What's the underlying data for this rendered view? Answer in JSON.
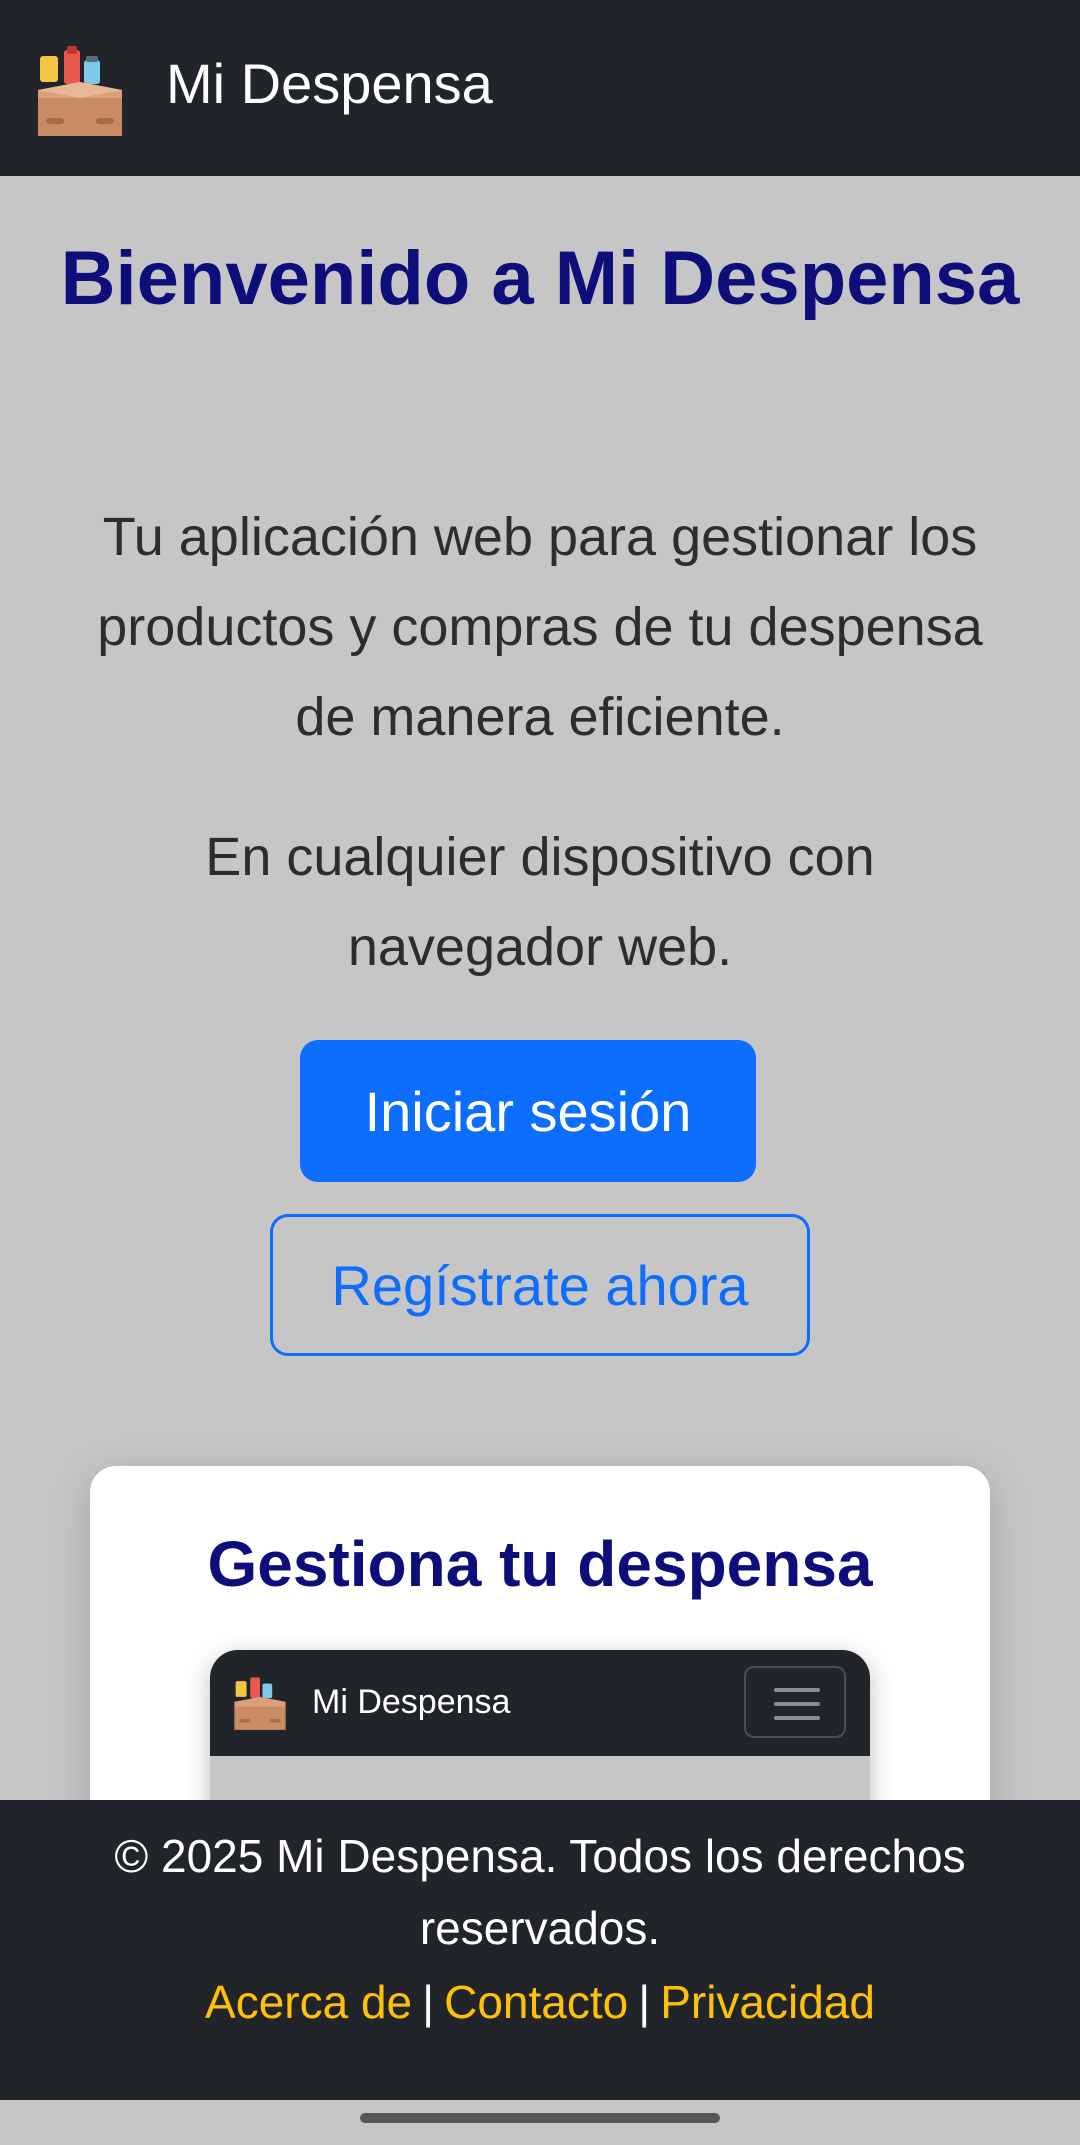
{
  "header": {
    "brand": "Mi Despensa",
    "logo_icon": "pantry-box-icon"
  },
  "hero": {
    "title": "Bienvenido a Mi Despensa",
    "description": "Tu aplicación web para gestionar los productos y compras de tu despensa de manera eficiente.",
    "devices_note": "En cualquier dispositivo con navegador web.",
    "login_label": "Iniciar sesión",
    "register_label": "Regístrate ahora"
  },
  "feature_card": {
    "title": "Gestiona tu despensa",
    "preview": {
      "brand": "Mi Despensa",
      "menu_icon": "hamburger-menu-icon"
    }
  },
  "footer": {
    "copyright": "© 2025 Mi Despensa. Todos los derechos reservados.",
    "links": [
      {
        "label": "Acerca de"
      },
      {
        "label": "Contacto"
      },
      {
        "label": "Privacidad"
      }
    ],
    "separator": "|"
  },
  "colors": {
    "navbar": "#212529",
    "background": "#c6c6c7",
    "title": "#0d0e7a",
    "primary": "#0d6efd",
    "footer_link": "#ffc107"
  }
}
